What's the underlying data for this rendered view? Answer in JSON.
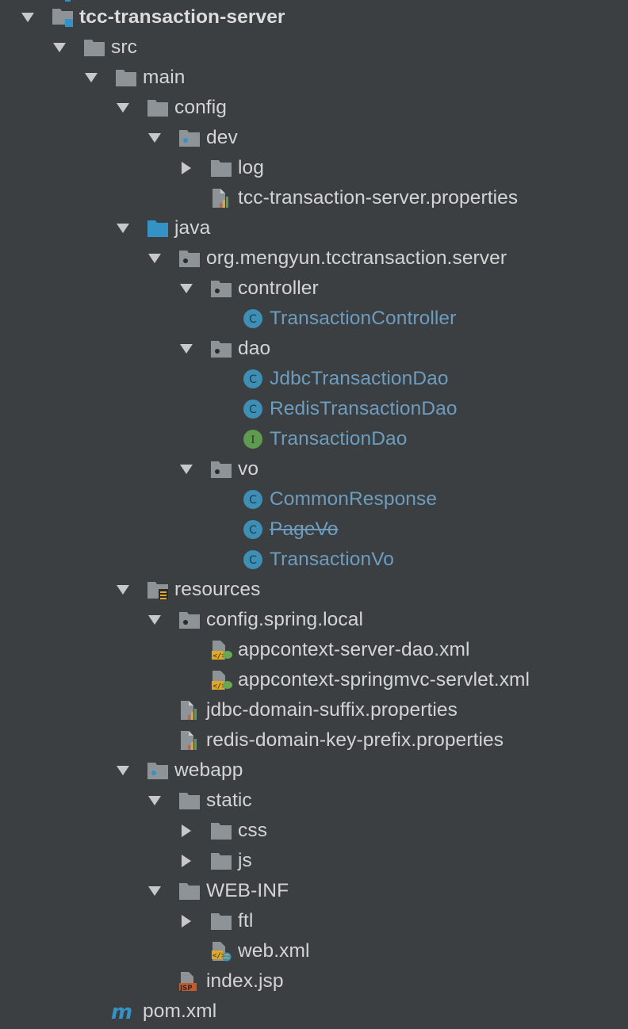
{
  "colors": {
    "background": "#3c3f41",
    "text": "#d4d4d4",
    "class_text": "#6d9cbe",
    "folder": "#8d9397",
    "source_folder": "#3592c4",
    "class_icon": "#3d8fb5",
    "interface_icon": "#5e9a4f"
  },
  "tree": [
    {
      "label": "tcc-transaction-server",
      "depth": 0,
      "arrow": "down",
      "icon": "module",
      "name": "tree-item-module-root",
      "bold": true
    },
    {
      "label": "src",
      "depth": 1,
      "arrow": "down",
      "icon": "folder",
      "name": "tree-item-src"
    },
    {
      "label": "main",
      "depth": 2,
      "arrow": "down",
      "icon": "folder",
      "name": "tree-item-main"
    },
    {
      "label": "config",
      "depth": 3,
      "arrow": "down",
      "icon": "folder",
      "name": "tree-item-config"
    },
    {
      "label": "dev",
      "depth": 4,
      "arrow": "down",
      "icon": "folder-dot",
      "name": "tree-item-dev"
    },
    {
      "label": "log",
      "depth": 5,
      "arrow": "right",
      "icon": "folder",
      "name": "tree-item-log"
    },
    {
      "label": "tcc-transaction-server.properties",
      "depth": 5,
      "arrow": "none",
      "icon": "properties",
      "name": "tree-item-tcc-transaction-server-properties"
    },
    {
      "label": "java",
      "depth": 3,
      "arrow": "down",
      "icon": "source-folder",
      "name": "tree-item-java"
    },
    {
      "label": "org.mengyun.tcctransaction.server",
      "depth": 4,
      "arrow": "down",
      "icon": "package",
      "name": "tree-item-server-package"
    },
    {
      "label": "controller",
      "depth": 5,
      "arrow": "down",
      "icon": "package",
      "name": "tree-item-controller"
    },
    {
      "label": "TransactionController",
      "depth": 6,
      "arrow": "none",
      "icon": "class",
      "name": "tree-item-transaction-controller",
      "kind": "cls"
    },
    {
      "label": "dao",
      "depth": 5,
      "arrow": "down",
      "icon": "package",
      "name": "tree-item-dao"
    },
    {
      "label": "JdbcTransactionDao",
      "depth": 6,
      "arrow": "none",
      "icon": "class",
      "name": "tree-item-jdbc-transaction-dao",
      "kind": "cls"
    },
    {
      "label": "RedisTransactionDao",
      "depth": 6,
      "arrow": "none",
      "icon": "class",
      "name": "tree-item-redis-transaction-dao",
      "kind": "cls"
    },
    {
      "label": "TransactionDao",
      "depth": 6,
      "arrow": "none",
      "icon": "interface",
      "name": "tree-item-transaction-dao",
      "kind": "cls"
    },
    {
      "label": "vo",
      "depth": 5,
      "arrow": "down",
      "icon": "package",
      "name": "tree-item-vo"
    },
    {
      "label": "CommonResponse",
      "depth": 6,
      "arrow": "none",
      "icon": "class",
      "name": "tree-item-common-response",
      "kind": "cls"
    },
    {
      "label": "PageVo",
      "depth": 6,
      "arrow": "none",
      "icon": "class",
      "name": "tree-item-page-vo",
      "kind": "cls",
      "strike": true
    },
    {
      "label": "TransactionVo",
      "depth": 6,
      "arrow": "none",
      "icon": "class",
      "name": "tree-item-transaction-vo",
      "kind": "cls"
    },
    {
      "label": "resources",
      "depth": 3,
      "arrow": "down",
      "icon": "resources",
      "name": "tree-item-resources"
    },
    {
      "label": "config.spring.local",
      "depth": 4,
      "arrow": "down",
      "icon": "package",
      "name": "tree-item-config-spring-local"
    },
    {
      "label": "appcontext-server-dao.xml",
      "depth": 5,
      "arrow": "none",
      "icon": "spring-xml",
      "name": "tree-item-appcontext-server-dao-xml"
    },
    {
      "label": "appcontext-springmvc-servlet.xml",
      "depth": 5,
      "arrow": "none",
      "icon": "spring-xml",
      "name": "tree-item-appcontext-springmvc-servlet-xml"
    },
    {
      "label": "jdbc-domain-suffix.properties",
      "depth": 4,
      "arrow": "none",
      "icon": "properties",
      "name": "tree-item-jdbc-domain-suffix-properties"
    },
    {
      "label": "redis-domain-key-prefix.properties",
      "depth": 4,
      "arrow": "none",
      "icon": "properties",
      "name": "tree-item-redis-domain-key-prefix-properties"
    },
    {
      "label": "webapp",
      "depth": 3,
      "arrow": "down",
      "icon": "folder-dot",
      "name": "tree-item-webapp"
    },
    {
      "label": "static",
      "depth": 4,
      "arrow": "down",
      "icon": "folder",
      "name": "tree-item-static"
    },
    {
      "label": "css",
      "depth": 5,
      "arrow": "right",
      "icon": "folder",
      "name": "tree-item-css"
    },
    {
      "label": "js",
      "depth": 5,
      "arrow": "right",
      "icon": "folder",
      "name": "tree-item-js"
    },
    {
      "label": "WEB-INF",
      "depth": 4,
      "arrow": "down",
      "icon": "folder",
      "name": "tree-item-web-inf"
    },
    {
      "label": "ftl",
      "depth": 5,
      "arrow": "right",
      "icon": "folder",
      "name": "tree-item-ftl"
    },
    {
      "label": "web.xml",
      "depth": 5,
      "arrow": "none",
      "icon": "web-xml",
      "name": "tree-item-web-xml"
    },
    {
      "label": "index.jsp",
      "depth": 4,
      "arrow": "none",
      "icon": "jsp",
      "name": "tree-item-index-jsp"
    },
    {
      "label": "pom.xml",
      "depth": 2,
      "arrow": "none",
      "icon": "maven",
      "name": "tree-item-pom-xml"
    }
  ]
}
